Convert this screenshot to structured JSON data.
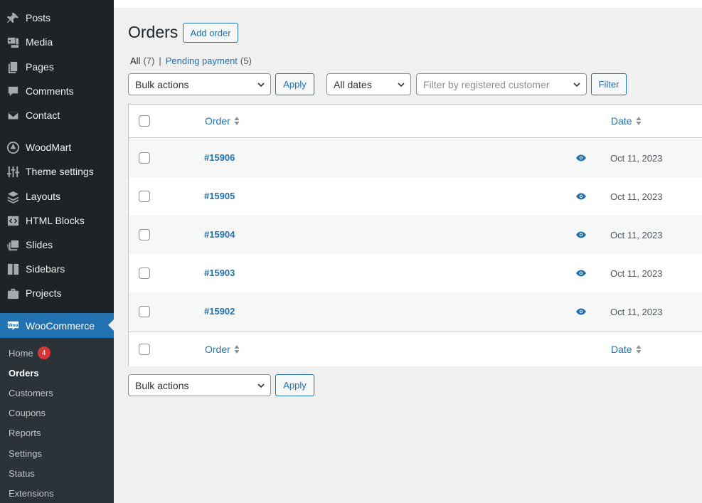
{
  "sidebar": {
    "items": [
      {
        "label": "Posts",
        "icon": "pin-icon"
      },
      {
        "label": "Media",
        "icon": "media-icon"
      },
      {
        "label": "Pages",
        "icon": "pages-icon"
      },
      {
        "label": "Comments",
        "icon": "comment-icon"
      },
      {
        "label": "Contact",
        "icon": "envelope-icon"
      },
      {
        "label": "WoodMart",
        "icon": "woodmart-icon"
      },
      {
        "label": "Theme settings",
        "icon": "sliders-icon"
      },
      {
        "label": "Layouts",
        "icon": "layers-icon"
      },
      {
        "label": "HTML Blocks",
        "icon": "code-block-icon"
      },
      {
        "label": "Slides",
        "icon": "slides-icon"
      },
      {
        "label": "Sidebars",
        "icon": "sidebar-icon"
      },
      {
        "label": "Projects",
        "icon": "briefcase-icon"
      },
      {
        "label": "WooCommerce",
        "icon": "woo-icon"
      }
    ],
    "submenu": [
      {
        "label": "Home",
        "badge": "4"
      },
      {
        "label": "Orders"
      },
      {
        "label": "Customers"
      },
      {
        "label": "Coupons"
      },
      {
        "label": "Reports"
      },
      {
        "label": "Settings"
      },
      {
        "label": "Status"
      },
      {
        "label": "Extensions"
      }
    ]
  },
  "main": {
    "title": "Orders",
    "add_button": "Add order",
    "views": {
      "all_label": "All",
      "all_count": "(7)",
      "separator": "|",
      "pending_label": "Pending payment",
      "pending_count": "(5)"
    },
    "bulk_actions": "Bulk actions",
    "apply": "Apply",
    "dates_filter": "All dates",
    "customer_filter_placeholder": "Filter by registered customer",
    "filter_button": "Filter",
    "columns": {
      "order": "Order",
      "date": "Date"
    },
    "rows": [
      {
        "order": "#15906",
        "date": "Oct 11, 2023"
      },
      {
        "order": "#15905",
        "date": "Oct 11, 2023"
      },
      {
        "order": "#15904",
        "date": "Oct 11, 2023"
      },
      {
        "order": "#15903",
        "date": "Oct 11, 2023"
      },
      {
        "order": "#15902",
        "date": "Oct 11, 2023"
      }
    ]
  },
  "colors": {
    "accent": "#2271b1",
    "sidebar": "#1d2327",
    "submenu": "#2c3338",
    "badge": "#d63638"
  }
}
